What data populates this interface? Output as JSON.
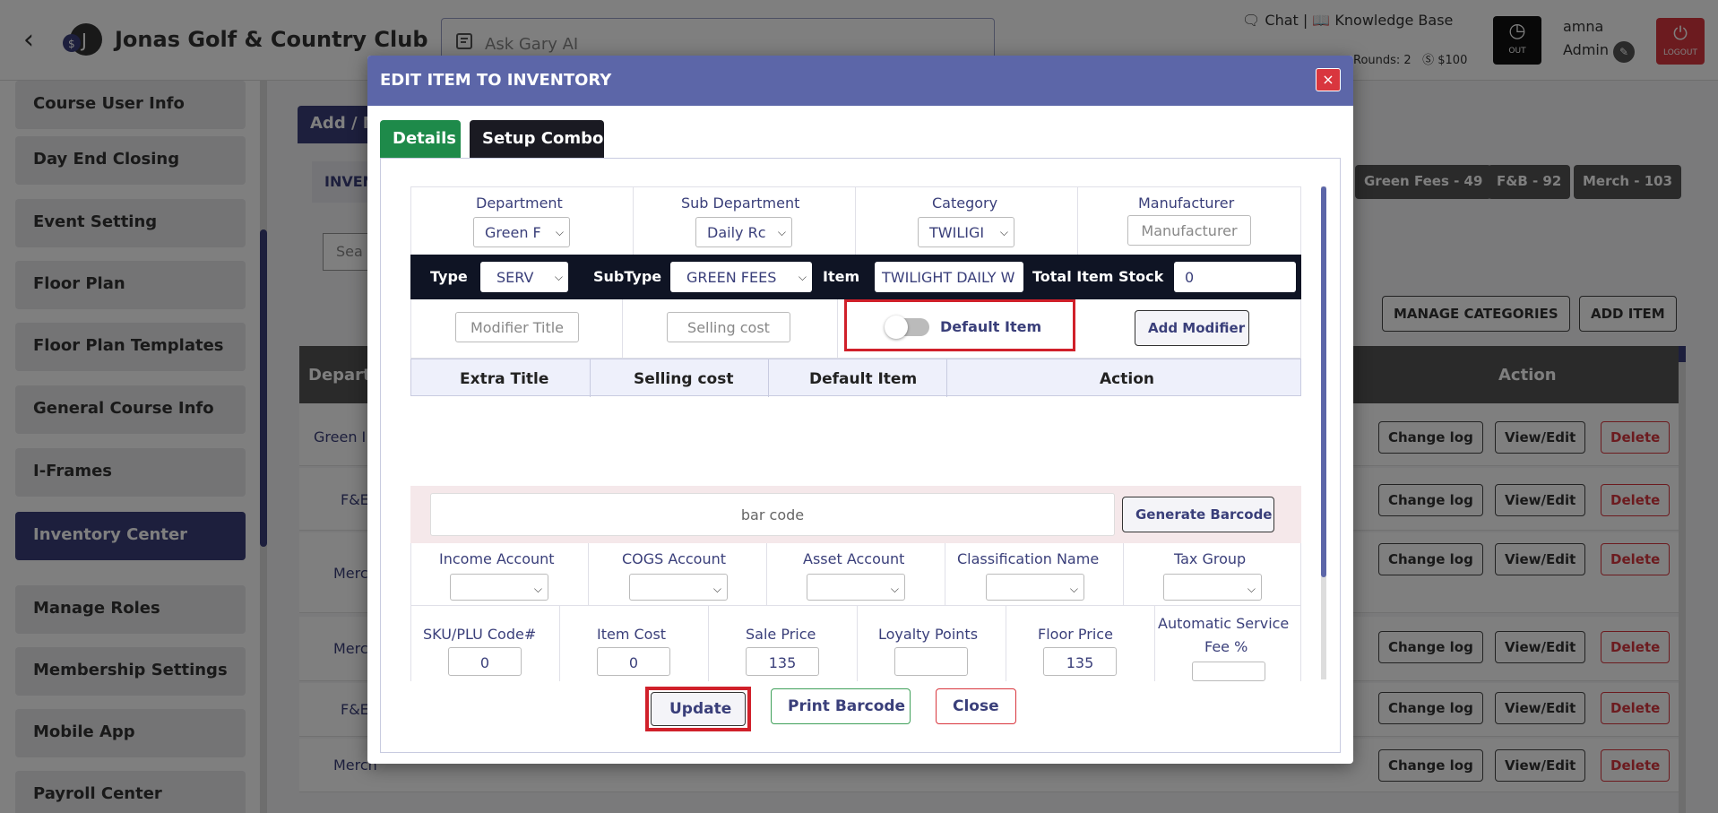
{
  "app": {
    "club_name": "Jonas Golf & Country Club",
    "ask_placeholder": "Ask Gary AI",
    "chat": "Chat",
    "knowledge_base": "Knowledge Base",
    "rounds": "Rounds: 2",
    "amount": "$100",
    "clock_label": "OUT",
    "user_name": "amna",
    "user_role": "Admin",
    "logout_label": "LOGOUT"
  },
  "sidebar": {
    "items": [
      {
        "label": "Course User Info"
      },
      {
        "label": "Day End Closing"
      },
      {
        "label": "Event Setting"
      },
      {
        "label": "Floor Plan"
      },
      {
        "label": "Floor Plan Templates"
      },
      {
        "label": "General Course Info"
      },
      {
        "label": "I-Frames"
      },
      {
        "label": "Inventory Center"
      },
      {
        "label": "Manage Roles"
      },
      {
        "label": "Membership Settings"
      },
      {
        "label": "Mobile App"
      },
      {
        "label": "Payroll Center"
      }
    ]
  },
  "background": {
    "add_tab": "Add / M",
    "inv_tab": "INVEN",
    "search": "Sea",
    "chips": [
      "Green Fees - 49",
      "F&B - 92",
      "Merch - 103"
    ],
    "manage_categories": "MANAGE CATEGORIES",
    "add_item": "ADD ITEM",
    "col_department": "Depart",
    "col_action": "Action",
    "rows": [
      {
        "dep": "Green I"
      },
      {
        "dep": "F&E"
      },
      {
        "dep": "Merc"
      },
      {
        "dep": "Merc"
      },
      {
        "dep": "F&E"
      },
      {
        "dep": "Merch"
      }
    ],
    "change_log": "Change log",
    "view_edit": "View/Edit",
    "delete": "Delete"
  },
  "modal": {
    "title": "EDIT ITEM TO INVENTORY",
    "close_glyph": "×",
    "tabs": {
      "details": "Details",
      "combo": "Setup Combo"
    },
    "department": {
      "label": "Department",
      "value": "Green F"
    },
    "sub_department": {
      "label": "Sub Department",
      "value": "Daily Rc"
    },
    "category": {
      "label": "Category",
      "value": "TWILIGI"
    },
    "manufacturer": {
      "label": "Manufacturer",
      "placeholder": "Manufacturer"
    },
    "type": {
      "label": "Type",
      "value": "SERV"
    },
    "subtype": {
      "label": "SubType",
      "value": "GREEN FEES"
    },
    "item": {
      "label": "Item",
      "value": "TWILIGHT DAILY W"
    },
    "total_stock": {
      "label": "Total Item Stock",
      "value": "0"
    },
    "modifier_title_placeholder": "Modifier Title",
    "selling_cost_placeholder": "Selling cost",
    "default_item_label": "Default Item",
    "add_modifier": "Add Modifier",
    "modifier_table": {
      "headers": [
        "Extra Title",
        "Selling cost",
        "Default Item",
        "Action"
      ]
    },
    "barcode_placeholder": "bar code",
    "generate_barcode": "Generate Barcode",
    "accounts": {
      "income": "Income Account",
      "cogs": "COGS Account",
      "asset": "Asset Account",
      "classification": "Classification Name",
      "tax": "Tax Group"
    },
    "pricing": {
      "sku_label": "SKU/PLU Code#",
      "sku_value": "0",
      "cost_label": "Item Cost",
      "cost_value": "0",
      "sale_label": "Sale Price",
      "sale_value": "135",
      "loyalty_label": "Loyalty Points",
      "loyalty_value": "",
      "floor_label": "Floor Price",
      "floor_value": "135",
      "service_fee_label_1": "Automatic Service",
      "service_fee_label_2": "Fee %"
    },
    "buttons": {
      "update": "Update",
      "print_barcode": "Print Barcode",
      "close": "Close"
    }
  },
  "colors": {
    "header_purple": "#5c66a8",
    "sidebar_active": "#3a3f7a",
    "details_tab": "#1e8a4a",
    "highlight_red": "#d0202a"
  }
}
